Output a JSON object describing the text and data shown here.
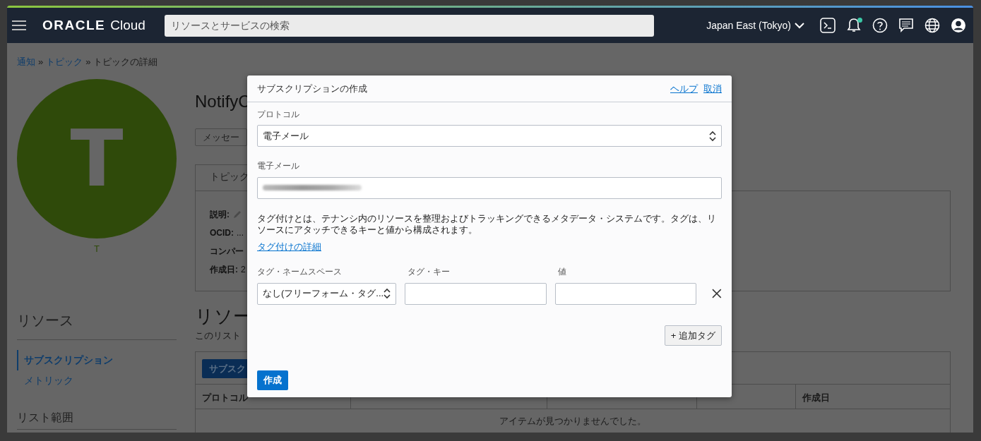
{
  "header": {
    "brand_strong": "ORACLE",
    "brand": "Cloud",
    "search": {
      "placeholder": "リソースとサービスの検索"
    },
    "region": "Japan East (Tokyo)",
    "notification_dot": true
  },
  "breadcrumb": [
    {
      "label": "通知",
      "kind": "link"
    },
    {
      "label": "»",
      "kind": "sep"
    },
    {
      "label": "トピック",
      "kind": "link"
    },
    {
      "label": "»",
      "kind": "sep"
    },
    {
      "label": "トピックの詳細",
      "kind": "current"
    }
  ],
  "avatar": {
    "letter": "T",
    "caption": "T"
  },
  "sidebar": {
    "title": "リソース",
    "items": [
      {
        "label": "サブスクリプション",
        "selected": true
      },
      {
        "label": "メトリック",
        "selected": false
      }
    ],
    "scope_title": "リスト範囲"
  },
  "topic": {
    "name": "NotifyC",
    "action_button": "メッセー",
    "details_tab": "トピック",
    "details": [
      {
        "label": "説明:",
        "kind": "edit"
      },
      {
        "label": "OCID:",
        "kind": "value",
        "value": "..."
      },
      {
        "label": "コンパー",
        "kind": "plain"
      },
      {
        "label": "作成日:",
        "kind": "value",
        "value": "2"
      }
    ]
  },
  "resources": {
    "title": "リソー",
    "description": "このリスト",
    "create_button": "サブスク",
    "table": {
      "columns": [
        {
          "label": "プロトコル"
        },
        {
          "covered": true
        },
        {
          "covered": true
        },
        {
          "covered": true
        },
        {
          "label": "作成日"
        }
      ],
      "empty_message": "アイテムが見つかりませんでした。"
    }
  },
  "dialog": {
    "title": "サブスクリプションの作成",
    "links": [
      "ヘルプ",
      "取消"
    ],
    "protocol": {
      "label": "プロトコル",
      "value": "電子メール"
    },
    "email": {
      "label": "電子メール",
      "redacted": true
    },
    "tag_info": "タグ付けとは、テナンシ内のリソースを整理およびトラッキングできるメタデータ・システムです。タグは、リソースにアタッチできるキーと値から構成されます。",
    "tag_link": "タグ付けの詳細",
    "tag_columns": [
      "タグ・ネームスペース",
      "タグ・キー",
      "値"
    ],
    "tag_row": {
      "namespace": "なし(フリーフォーム・タグ..."
    },
    "add_tag_button": "+ 追加タグ",
    "create_button": "作成"
  }
}
